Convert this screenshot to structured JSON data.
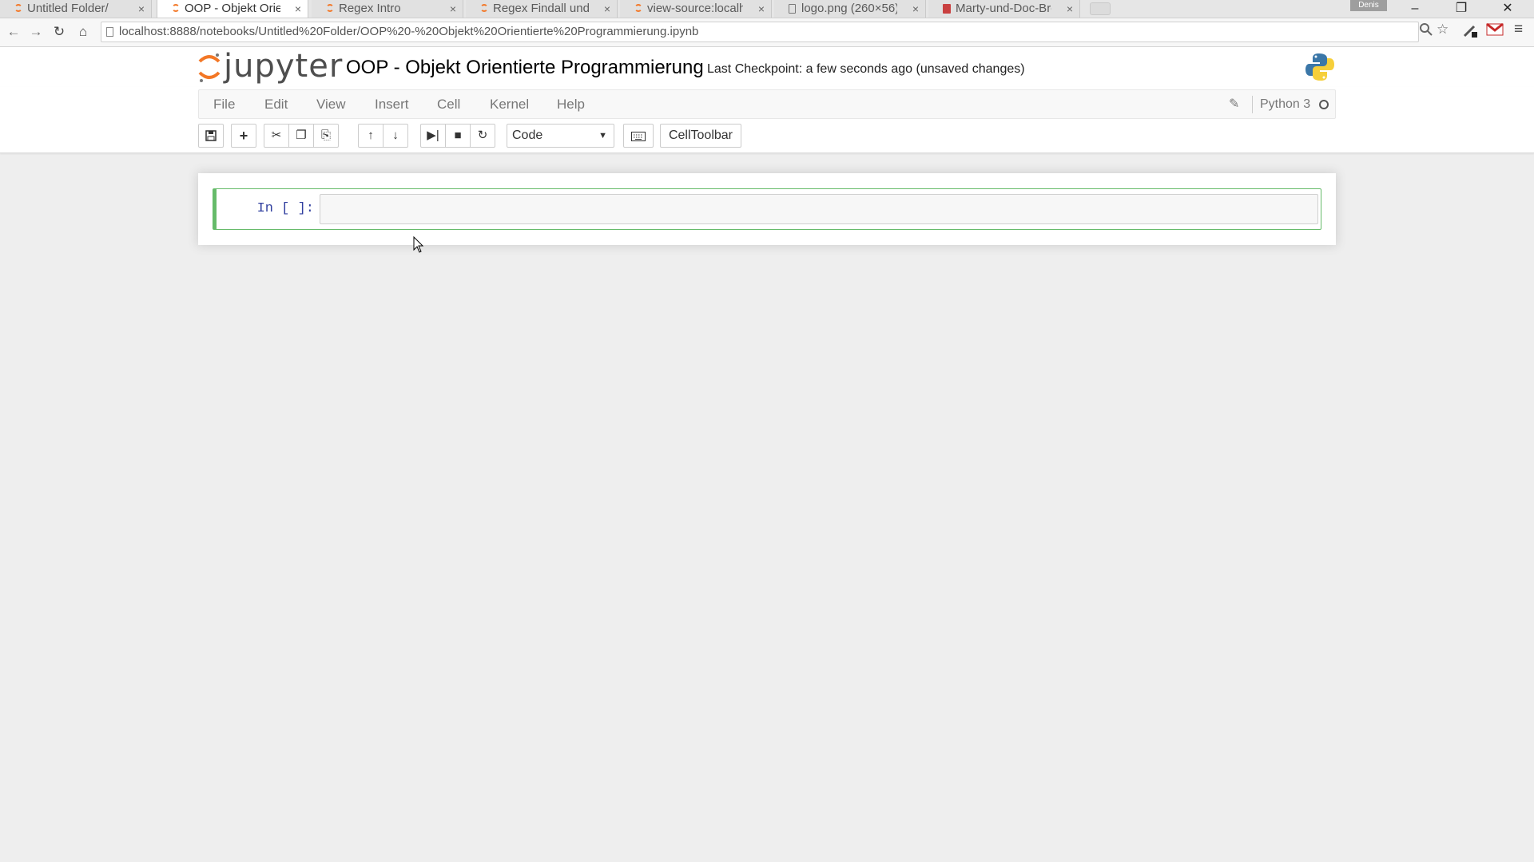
{
  "browser": {
    "tabs": [
      {
        "title": "Untitled Folder/",
        "icon": "jupyter-icon",
        "active": false
      },
      {
        "title": "OOP - Objekt Orient",
        "icon": "jupyter-icon",
        "active": true
      },
      {
        "title": "Regex Intro",
        "icon": "jupyter-icon",
        "active": false
      },
      {
        "title": "Regex Findall und Sp",
        "icon": "jupyter-icon",
        "active": false
      },
      {
        "title": "view-source:localhos",
        "icon": "jupyter-icon",
        "active": false
      },
      {
        "title": "logo.png (260×56)",
        "icon": "document-icon",
        "active": false
      },
      {
        "title": "Marty-und-Doc-Bro",
        "icon": "magazine-icon",
        "active": false
      }
    ],
    "close_glyph": "×",
    "user_badge": "Denis",
    "window_controls": {
      "minimize": "–",
      "restore": "❐",
      "close": "✕"
    },
    "url": "localhost:8888/notebooks/Untitled%20Folder/OOP%20-%20Objekt%20Orientierte%20Programmierung.ipynb"
  },
  "jupyter": {
    "logo_text": "jupyter",
    "notebook_title": "OOP - Objekt Orientierte Programmierung",
    "checkpoint_text": "Last Checkpoint: a few seconds ago (unsaved changes)",
    "menu": [
      "File",
      "Edit",
      "View",
      "Insert",
      "Cell",
      "Kernel",
      "Help"
    ],
    "kernel_name": "Python 3",
    "cell_type": "Code",
    "celltoolbar_label": "CellToolbar",
    "cell": {
      "prompt": "In [ ]:",
      "source": ""
    }
  },
  "colors": {
    "jupyter_orange": "#f37726",
    "edit_mode_green": "#66bb6a",
    "prompt_blue": "#303f9f"
  }
}
